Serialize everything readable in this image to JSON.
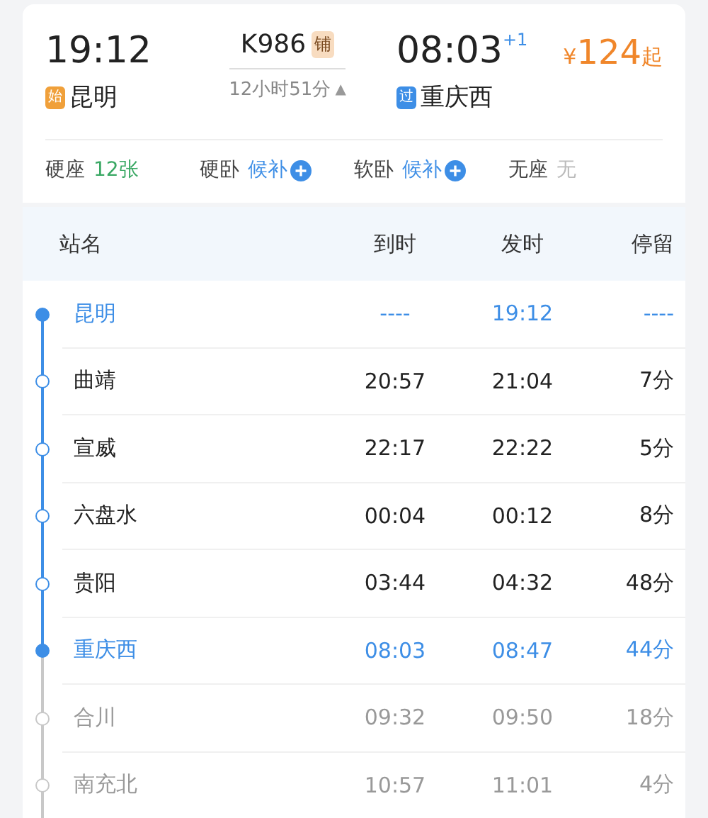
{
  "trip": {
    "depart_time": "19:12",
    "origin_tag": "始",
    "origin": "昆明",
    "train": "K986",
    "train_tag": "铺",
    "duration": "12小时51分",
    "duration_caret": "▲",
    "arrive_time": "08:03",
    "day_offset": "+1",
    "dest_tag": "过",
    "destination": "重庆西",
    "price_currency": "¥",
    "price": "124",
    "price_suffix": "起"
  },
  "seats": [
    {
      "name": "硬座",
      "kind": "count",
      "status": "12张"
    },
    {
      "name": "硬卧",
      "kind": "waitlist",
      "status": "候补"
    },
    {
      "name": "软卧",
      "kind": "waitlist",
      "status": "候补"
    },
    {
      "name": "无座",
      "kind": "none",
      "status": "无"
    }
  ],
  "table": {
    "columns": [
      "站名",
      "到时",
      "发时",
      "停留"
    ],
    "rows": [
      {
        "station": "昆明",
        "arrive": "----",
        "depart": "19:12",
        "stop": "----",
        "kind": "endpoint"
      },
      {
        "station": "曲靖",
        "arrive": "20:57",
        "depart": "21:04",
        "stop": "7分",
        "kind": "intermediate"
      },
      {
        "station": "宣威",
        "arrive": "22:17",
        "depart": "22:22",
        "stop": "5分",
        "kind": "intermediate"
      },
      {
        "station": "六盘水",
        "arrive": "00:04",
        "depart": "00:12",
        "stop": "8分",
        "kind": "intermediate"
      },
      {
        "station": "贵阳",
        "arrive": "03:44",
        "depart": "04:32",
        "stop": "48分",
        "kind": "intermediate"
      },
      {
        "station": "重庆西",
        "arrive": "08:03",
        "depart": "08:47",
        "stop": "44分",
        "kind": "endpoint"
      },
      {
        "station": "合川",
        "arrive": "09:32",
        "depart": "09:50",
        "stop": "18分",
        "kind": "beyond"
      },
      {
        "station": "南充北",
        "arrive": "10:57",
        "depart": "11:01",
        "stop": "4分",
        "kind": "beyond"
      }
    ]
  }
}
